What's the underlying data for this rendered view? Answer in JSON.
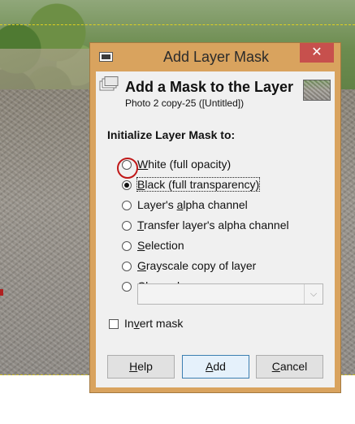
{
  "window": {
    "title": "Add Layer Mask",
    "close_glyph": "✕"
  },
  "header": {
    "title": "Add a Mask to the Layer",
    "subtitle": "Photo 2 copy-25 ([Untitled])",
    "icon": "layer-mask-icon"
  },
  "section": {
    "label": "Initialize Layer Mask to:"
  },
  "options": [
    {
      "pre": "",
      "mn": "W",
      "post": "hite (full opacity)",
      "checked": false
    },
    {
      "pre": "",
      "mn": "B",
      "post": "lack (full transparency)",
      "checked": true
    },
    {
      "pre": "Layer's ",
      "mn": "a",
      "post": "lpha channel",
      "checked": false
    },
    {
      "pre": "",
      "mn": "T",
      "post": "ransfer layer's alpha channel",
      "checked": false
    },
    {
      "pre": "",
      "mn": "S",
      "post": "election",
      "checked": false
    },
    {
      "pre": "",
      "mn": "G",
      "post": "rayscale copy of layer",
      "checked": false
    },
    {
      "pre": "",
      "mn": "C",
      "post": "hannel",
      "checked": false
    }
  ],
  "channel_select": {
    "value": "",
    "arrow_glyph": "⌵"
  },
  "invert": {
    "pre": "In",
    "mn": "v",
    "post": "ert mask",
    "checked": false
  },
  "buttons": {
    "help": {
      "pre": "",
      "mn": "H",
      "post": "elp"
    },
    "add": {
      "pre": "",
      "mn": "A",
      "post": "dd"
    },
    "cancel": {
      "pre": "",
      "mn": "C",
      "post": "ancel"
    }
  },
  "colors": {
    "window_frame": "#d9a35e",
    "close_button": "#c7504d",
    "annotation_circle": "#c01818",
    "default_button_border": "#3c7fb1"
  }
}
